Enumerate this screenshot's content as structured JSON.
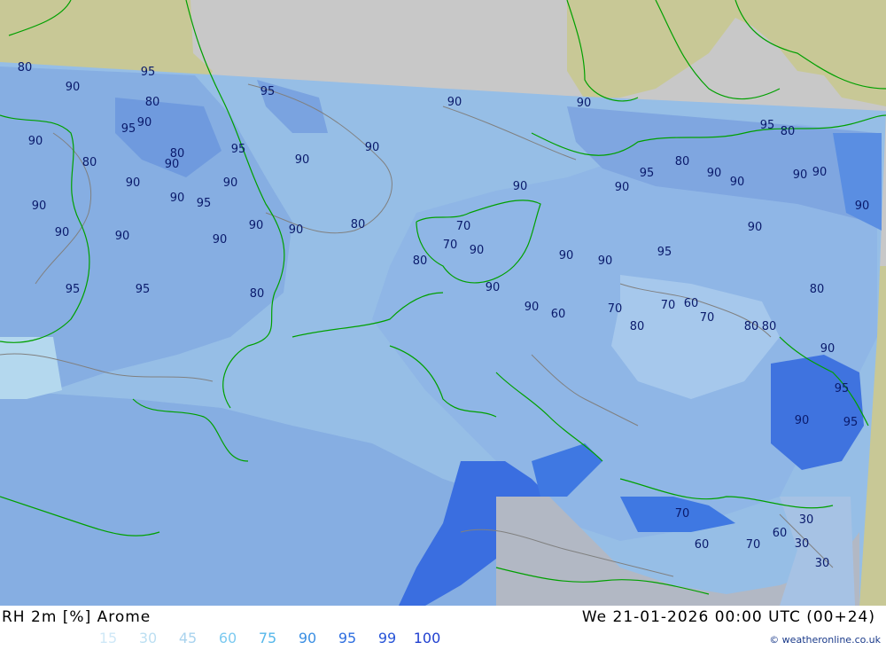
{
  "title": "RH 2m [%] Arome",
  "valid_time": "We 21-01-2026 00:00 UTC (00+24)",
  "legend": [
    {
      "label": "15",
      "color": "#cfe8f7"
    },
    {
      "label": "30",
      "color": "#bcdff2"
    },
    {
      "label": "45",
      "color": "#a9d3ee"
    },
    {
      "label": "60",
      "color": "#7ccaf0"
    },
    {
      "label": "75",
      "color": "#56b7ea"
    },
    {
      "label": "90",
      "color": "#3b8fe3"
    },
    {
      "label": "95",
      "color": "#2f6fe0"
    },
    {
      "label": "99",
      "color": "#2855d8"
    },
    {
      "label": "100",
      "color": "#2040d0"
    }
  ],
  "credit": "© weatheronline.co.uk",
  "colors": {
    "land_outside": "#c8c896",
    "water_outside": "#c8c8c8",
    "sea": "#96bee6",
    "coast": "#00a000",
    "contour": "#808080"
  },
  "contour_labels": [
    "80",
    "90",
    "95",
    "80",
    "90",
    "95",
    "90",
    "90",
    "95",
    "80",
    "90",
    "80",
    "90",
    "95",
    "90",
    "90",
    "90",
    "90",
    "95",
    "90",
    "90",
    "90",
    "90",
    "95",
    "80",
    "90",
    "90",
    "95",
    "80",
    "90",
    "90",
    "90",
    "90",
    "90",
    "90",
    "90",
    "80",
    "90",
    "70",
    "70",
    "80",
    "90",
    "90",
    "90",
    "95",
    "90",
    "95",
    "95",
    "80",
    "90",
    "90",
    "60",
    "70",
    "80",
    "70",
    "60",
    "70",
    "80",
    "80",
    "90",
    "95",
    "90",
    "95",
    "30",
    "30",
    "30",
    "70",
    "60",
    "70",
    "60",
    "80"
  ]
}
